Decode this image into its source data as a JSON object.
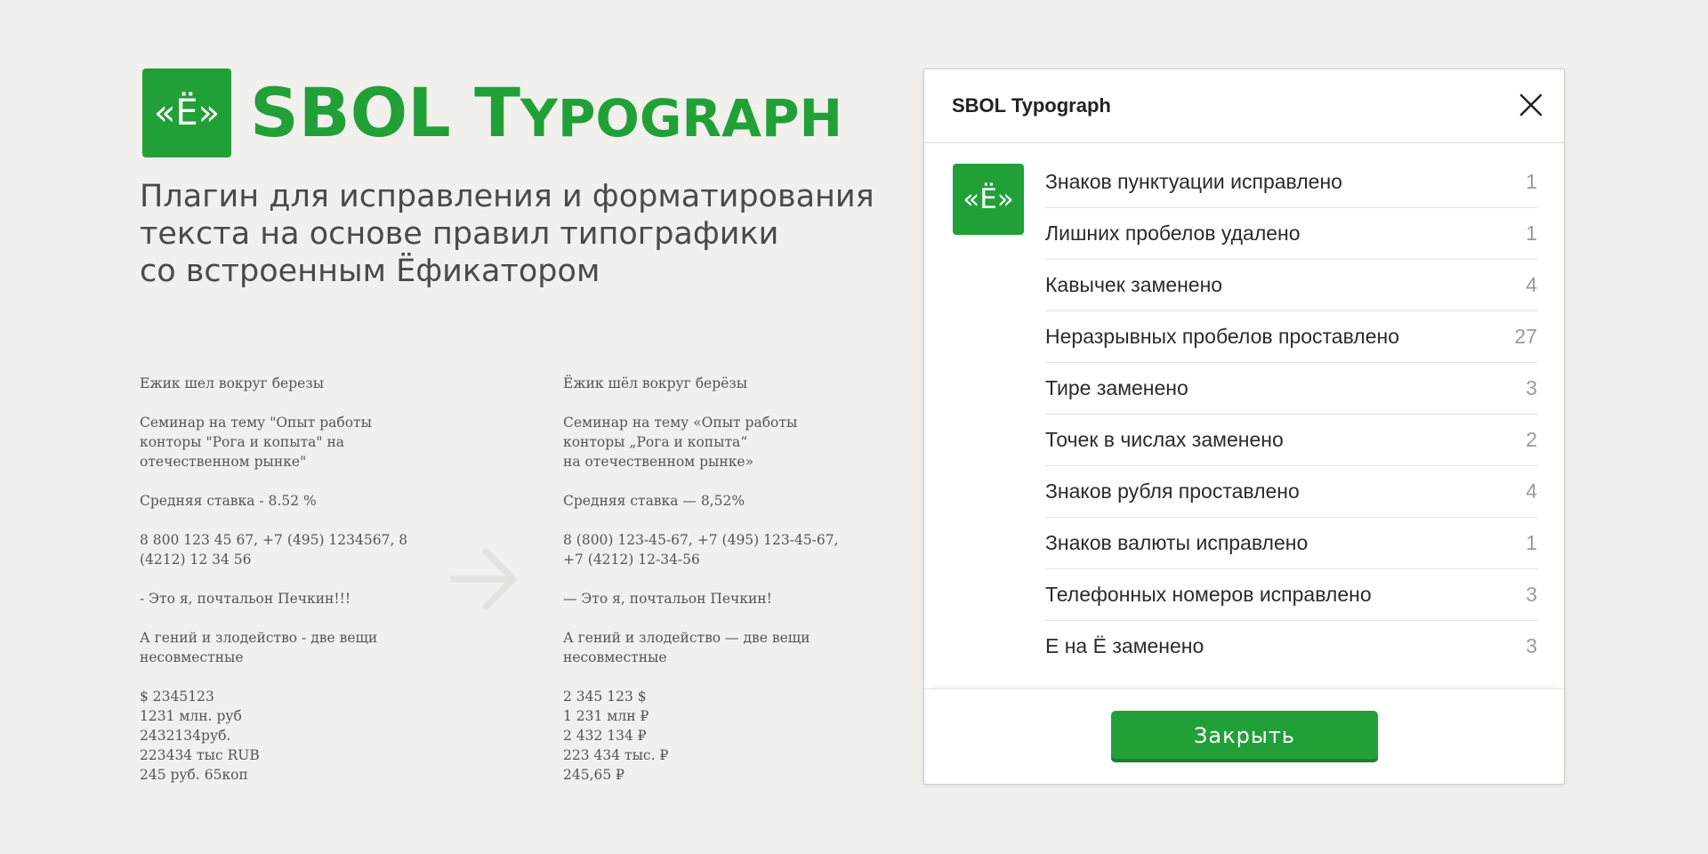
{
  "hero": {
    "logo_text": "«Ё»",
    "title_main": "SBOL T",
    "title_smallcaps": "YPOGRAPH",
    "subtitle_lines": [
      "Плагин для исправления и форматирования",
      "текста на основе правил типографики",
      "со встроенным Ёфикатором"
    ]
  },
  "examples": {
    "before": [
      [
        "Ежик шел вокруг березы"
      ],
      [
        "Семинар на тему \"Опыт работы",
        "конторы \"Рога и копыта\" на",
        "отечественном рынке\""
      ],
      [
        "Средняя ставка - 8.52 %"
      ],
      [
        "8 800 123 45 67, +7 (495) 1234567, 8",
        "(4212) 12 34 56"
      ],
      [
        "- Это я, почтальон Печкин!!!"
      ],
      [
        "А гений и злодейство - две вещи",
        "несовместные"
      ],
      [
        "$ 2345123",
        "1231 млн. руб",
        "2432134руб.",
        "223434 тыс RUB",
        "245 руб. 65коп"
      ]
    ],
    "after": [
      [
        "Ёжик шёл вокруг берёзы"
      ],
      [
        "Семинар на тему «Опыт работы",
        "конторы „Рога и копыта“",
        "на отечественном рынке»"
      ],
      [
        "Средняя ставка —  8,52%"
      ],
      [
        "8 (800) 123-45-67, +7 (495) 123-45-67,",
        "+7 (4212) 12-34-56"
      ],
      [
        "— Это я, почтальон Печкин!"
      ],
      [
        "А гений и злодейство — две вещи",
        "несовместные"
      ],
      [
        "2 345 123 $",
        "1 231 млн ₽",
        "2 432 134 ₽",
        "223 434 тыс. ₽",
        "245,65 ₽"
      ]
    ]
  },
  "dialog": {
    "title": "SBOL Typograph",
    "logo_text": "«Ё»",
    "stats": [
      {
        "label": "Знаков пунктуации исправлено",
        "count": "1"
      },
      {
        "label": "Лишних пробелов удалено",
        "count": "1"
      },
      {
        "label": "Кавычек заменено",
        "count": "4"
      },
      {
        "label": "Неразрывных пробелов проставлено",
        "count": "27"
      },
      {
        "label": "Тире заменено",
        "count": "3"
      },
      {
        "label": "Точек в числах заменено",
        "count": "2"
      },
      {
        "label": "Знаков рубля проставлено",
        "count": "4"
      },
      {
        "label": "Знаков валюты исправлено",
        "count": "1"
      },
      {
        "label": "Телефонных номеров исправлено",
        "count": "3"
      },
      {
        "label": "Е на Ё заменено",
        "count": "3"
      }
    ],
    "close_button": "Закрыть"
  },
  "colors": {
    "brand_green": "#21a038",
    "background": "#f1f0ec"
  },
  "icons": {
    "arrow": "arrow-right-icon",
    "close": "close-icon"
  }
}
